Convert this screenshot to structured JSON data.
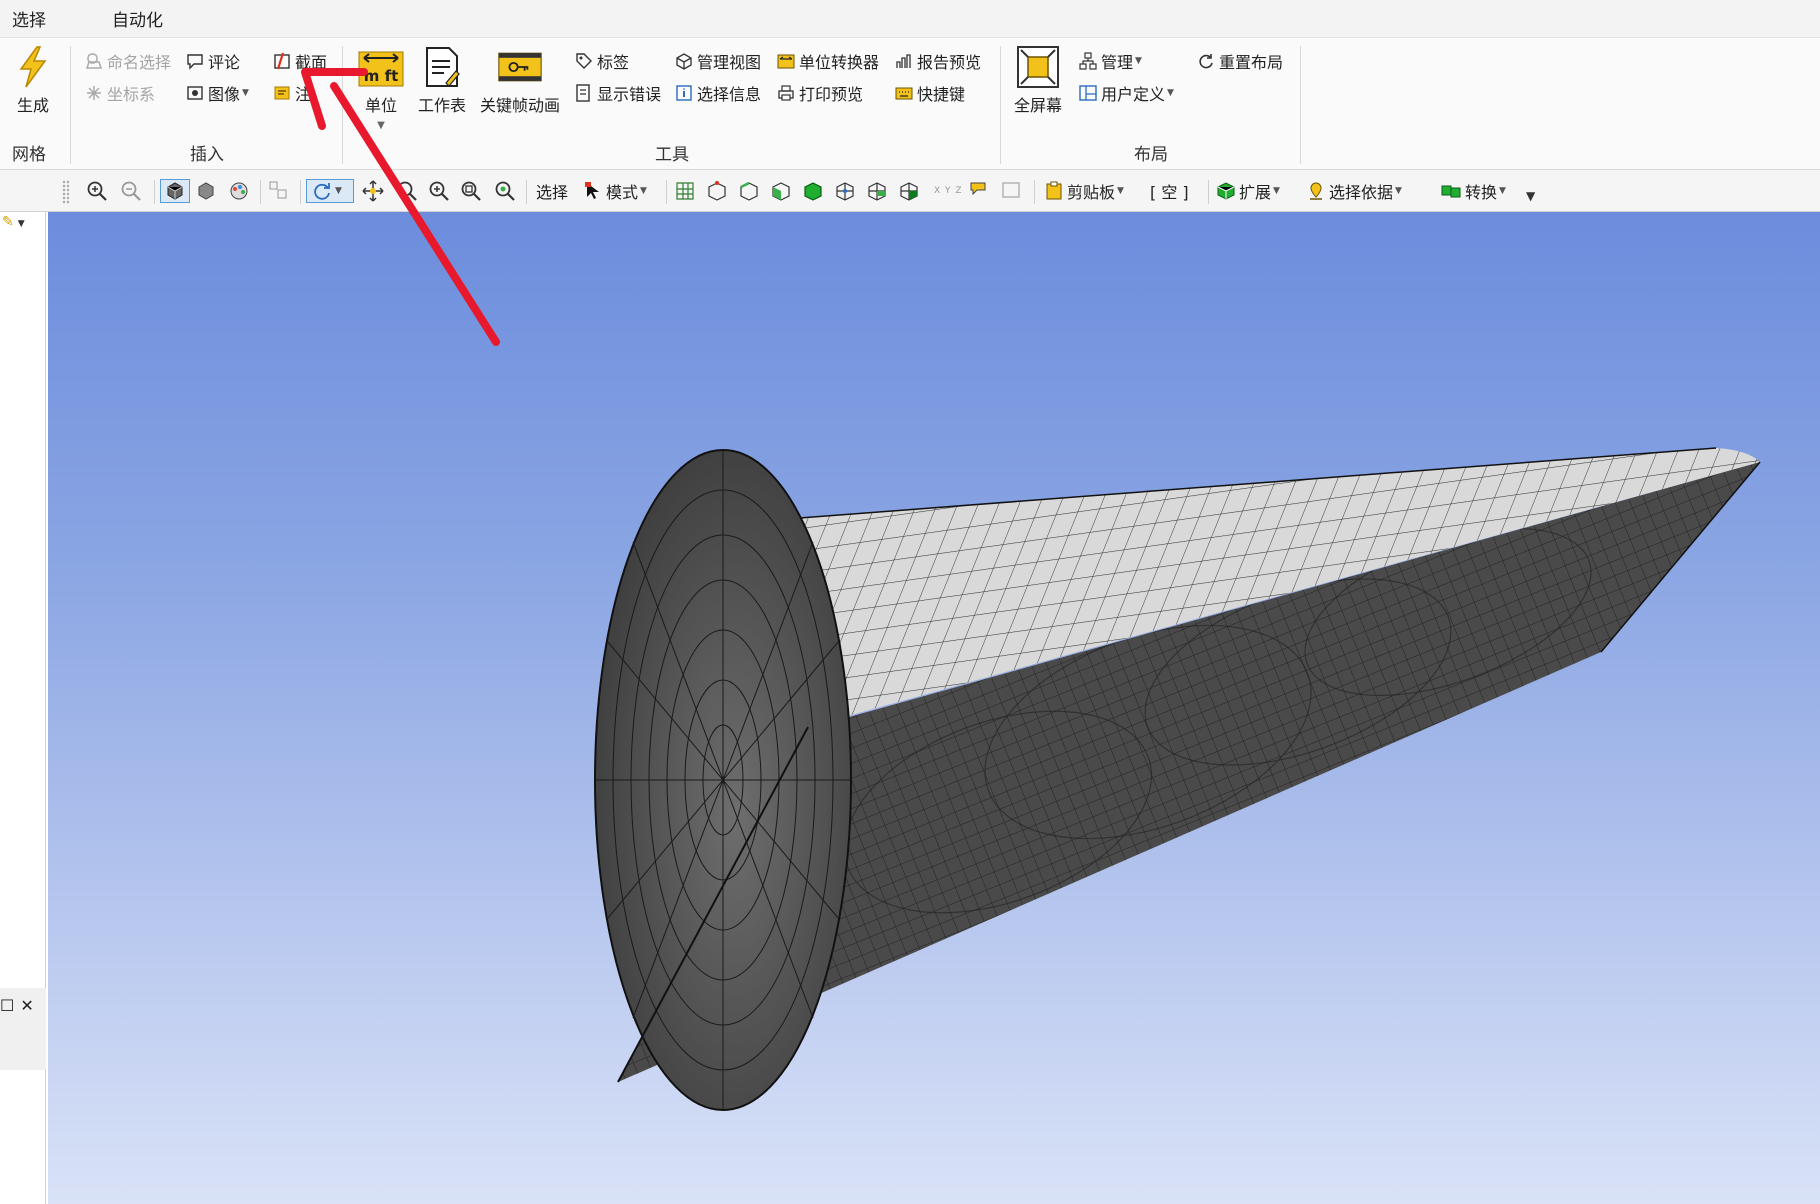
{
  "menu": {
    "tabs": [
      "选择",
      "自动化"
    ]
  },
  "ribbon": {
    "groups": {
      "mesh": {
        "label": "网格",
        "generate": "生成"
      },
      "insert": {
        "label": "插入",
        "named_selection": "命名选择",
        "coordinate_system": "坐标系",
        "comment": "评论",
        "image": "图像",
        "section": "截面",
        "annotation_partial": "注"
      },
      "tools": {
        "label": "工具",
        "units": "单位",
        "units_icon_text": "m ft",
        "worksheet": "工作表",
        "keyframe_animation": "关键帧动画",
        "tags": "标签",
        "show_errors": "显示错误",
        "manage_views": "管理视图",
        "selection_info": "选择信息",
        "unit_converter": "单位转换器",
        "print_preview": "打印预览",
        "report_preview": "报告预览",
        "shortcuts": "快捷键"
      },
      "layout": {
        "label": "布局",
        "fullscreen": "全屏幕",
        "manage": "管理",
        "user_defined": "用户定义",
        "reset_layout": "重置布局"
      }
    }
  },
  "toolbar": {
    "select_label": "选择",
    "mode_label": "模式",
    "clipboard_label": "剪贴板",
    "clipboard_value": "[ 空 ]",
    "extend_label": "扩展",
    "select_by_label": "选择依据",
    "convert_label": "转换",
    "triad_label": "X Y Z"
  },
  "colors": {
    "annotation_arrow": "#e8192c",
    "accent_blue": "#5b9bd5",
    "icon_gold": "#e9b227",
    "viewport_top": "#6c8ddd",
    "viewport_bottom": "#d9e2f7"
  }
}
